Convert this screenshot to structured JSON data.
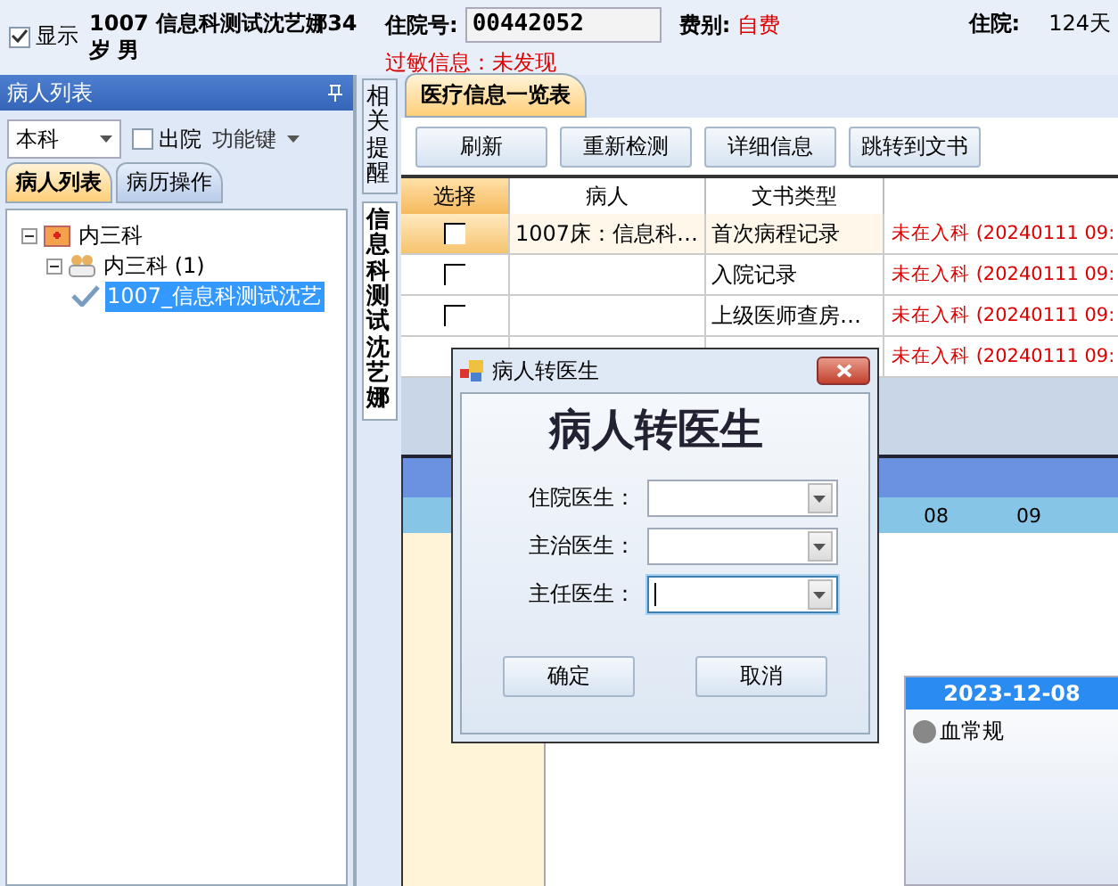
{
  "header": {
    "show": {
      "label": "显示",
      "checked": true
    },
    "patient": "1007 信息科测试沈艺娜34 岁 男",
    "admission_label": "住院号:",
    "admission_no": "00442052",
    "fee_label": "费别:",
    "fee": "自费",
    "stay_label": "住院:",
    "stay": "124天",
    "allergy": "过敏信息：未发现"
  },
  "left_panel": {
    "title": "病人列表",
    "filter": "本科",
    "discharged": {
      "label": "出院",
      "checked": false
    },
    "function_menu": "功能键",
    "tabs": [
      {
        "label": "病人列表",
        "selected": true
      },
      {
        "label": "病历操作",
        "selected": false
      }
    ],
    "tree": [
      {
        "label": "内三科",
        "kind": "department",
        "selected": false,
        "expanded": true,
        "children": [
          {
            "label": "内三科 (1)",
            "kind": "ward",
            "selected": false,
            "expanded": true,
            "children": [
              {
                "label": "1007_信息科测试沈艺",
                "kind": "patient",
                "selected": true
              }
            ]
          }
        ]
      }
    ]
  },
  "side_tabs": [
    {
      "label": "相关提醒",
      "selected": false
    },
    {
      "label": "信息科测试沈艺娜",
      "selected": true
    }
  ],
  "main": {
    "tab": "医疗信息一览表",
    "buttons": [
      "刷新",
      "重新检测",
      "详细信息",
      "跳转到文书"
    ],
    "table": {
      "columns": [
        "选择",
        "病人",
        "文书类型"
      ],
      "rows": [
        {
          "checked": false,
          "selected": true,
          "patient": "1007床：信息科…",
          "doc_type": "首次病程记录",
          "status": "未在入科 (20240111 09:"
        },
        {
          "checked": false,
          "selected": false,
          "doc_type": "入院记录",
          "status": "未在入科 (20240111 09:"
        },
        {
          "checked": false,
          "selected": false,
          "doc_type": "上级医师查房…",
          "status": "未在入科 (20240111 09:"
        },
        {
          "selected": false,
          "status": "未在入科 (20240111 09:"
        }
      ]
    },
    "timeline": {
      "hours": [
        "08",
        "09"
      ],
      "date": "2023-12-08",
      "events": [
        "血常规"
      ]
    }
  },
  "dialog": {
    "title": "病人转医生",
    "heading": "病人转医生",
    "fields": [
      {
        "label": "住院医生：",
        "focused": false
      },
      {
        "label": "主治医生：",
        "focused": false
      },
      {
        "label": "主任医生：",
        "focused": true
      }
    ],
    "buttons": [
      "确定",
      "取消"
    ]
  }
}
